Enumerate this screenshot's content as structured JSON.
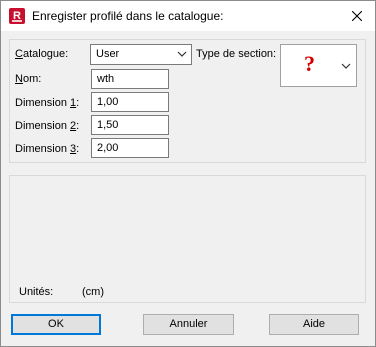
{
  "window": {
    "title": "Enregister profilé dans le catalogue:"
  },
  "form": {
    "catalogue_label_u": "C",
    "catalogue_label_rest": "atalogue:",
    "catalogue_value": "User",
    "section_type_label": "Type de section:",
    "section_type_glyph": "?",
    "nom_label_u": "N",
    "nom_label_rest": "om:",
    "nom_value": "wth",
    "dim1_label_pre": "Dimension ",
    "dim1_label_u": "1",
    "dim1_label_post": ":",
    "dim1_value": "1,00",
    "dim2_label_pre": "Dimension ",
    "dim2_label_u": "2",
    "dim2_label_post": ":",
    "dim2_value": "1,50",
    "dim3_label_pre": "Dimension ",
    "dim3_label_u": "3",
    "dim3_label_post": ":",
    "dim3_value": "2,00"
  },
  "units": {
    "label": "Unités:",
    "value": "(cm)"
  },
  "buttons": {
    "ok": "OK",
    "cancel": "Annuler",
    "help": "Aide"
  },
  "colors": {
    "accent": "#0078d7",
    "question_mark": "#d40000",
    "app_icon": "#c8102e"
  },
  "icons": {
    "app": "app-icon",
    "close": "close-icon",
    "dropdown": "chevron-down-icon"
  }
}
